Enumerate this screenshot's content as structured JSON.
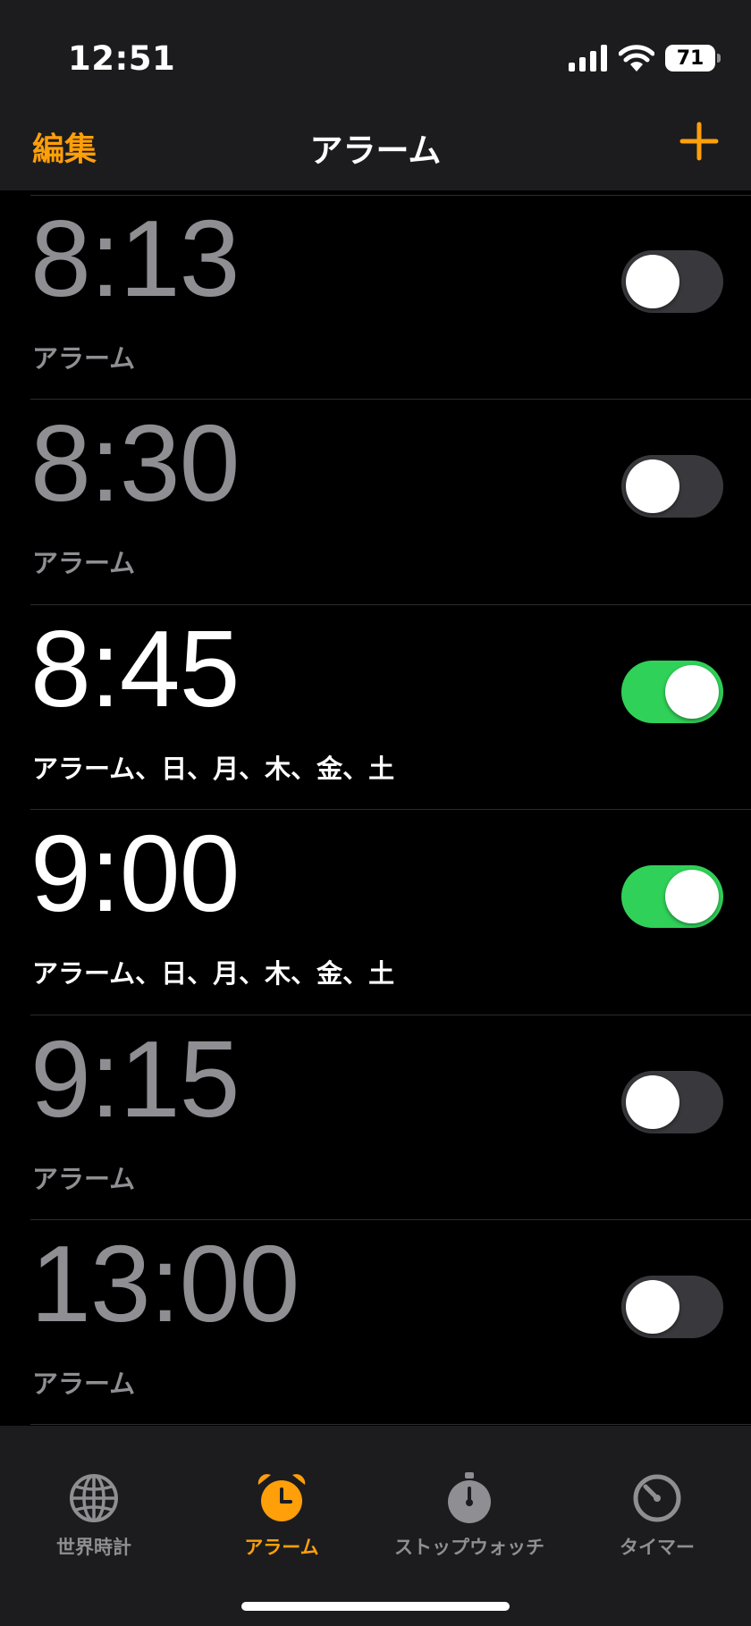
{
  "status_bar": {
    "time": "12:51",
    "battery": "71",
    "icons": [
      "cellular-signal-icon",
      "wifi-icon",
      "battery-icon"
    ]
  },
  "nav": {
    "edit_label": "編集",
    "title": "アラーム",
    "add_icon": "plus-icon"
  },
  "colors": {
    "accent": "#ff9f0a",
    "toggle_on": "#30d158",
    "toggle_off": "#39393d",
    "inactive_text": "#8e8e93"
  },
  "alarms": [
    {
      "time": "8:13",
      "label": "アラーム",
      "enabled": false
    },
    {
      "time": "8:30",
      "label": "アラーム",
      "enabled": false
    },
    {
      "time": "8:45",
      "label": "アラーム、日、月、木、金、土",
      "enabled": true
    },
    {
      "time": "9:00",
      "label": "アラーム、日、月、木、金、土",
      "enabled": true
    },
    {
      "time": "9:15",
      "label": "アラーム",
      "enabled": false
    },
    {
      "time": "13:00",
      "label": "アラーム",
      "enabled": false
    }
  ],
  "tabs": [
    {
      "label": "世界時計",
      "icon": "globe-icon",
      "active": false
    },
    {
      "label": "アラーム",
      "icon": "alarm-clock-icon",
      "active": true
    },
    {
      "label": "ストップウォッチ",
      "icon": "stopwatch-icon",
      "active": false
    },
    {
      "label": "タイマー",
      "icon": "timer-icon",
      "active": false
    }
  ]
}
